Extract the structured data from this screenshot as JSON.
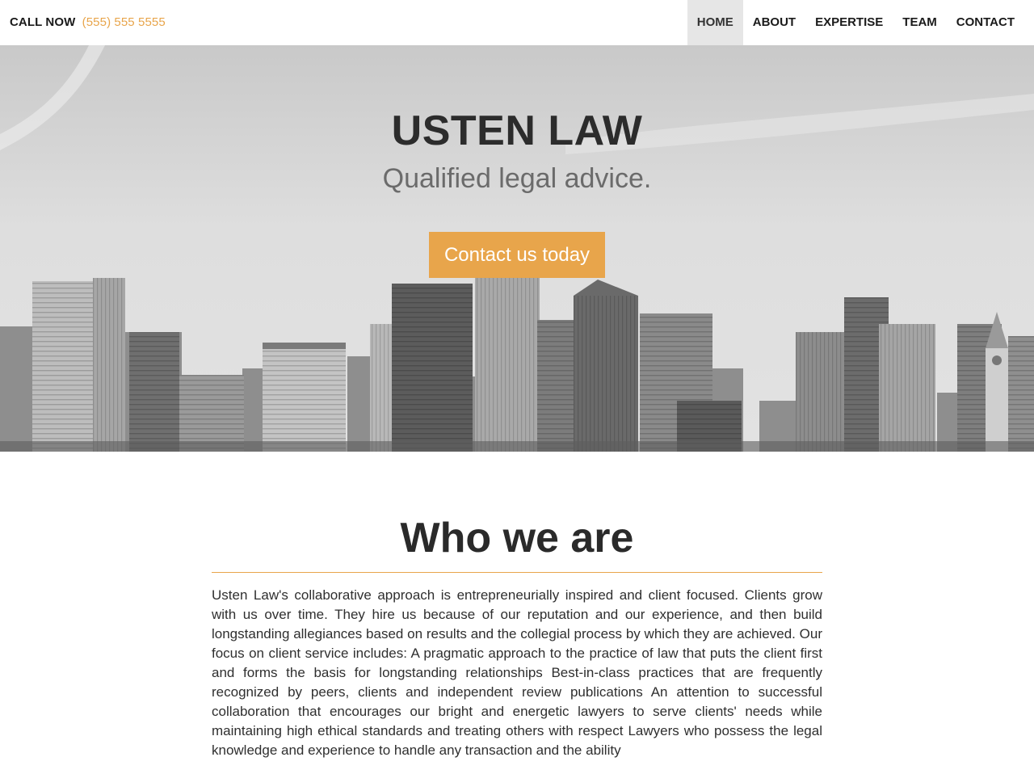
{
  "colors": {
    "accent": "#e8a54b",
    "nav_active_bg": "#e6e6e6",
    "text_dark": "#222222",
    "subtitle_gray": "#6b6b6b"
  },
  "header": {
    "call_label": "CALL NOW",
    "phone": "(555) 555 5555",
    "nav": [
      {
        "label": "HOME",
        "active": true
      },
      {
        "label": "ABOUT",
        "active": false
      },
      {
        "label": "EXPERTISE",
        "active": false
      },
      {
        "label": "TEAM",
        "active": false
      },
      {
        "label": "CONTACT",
        "active": false
      }
    ]
  },
  "hero": {
    "title": "USTEN LAW",
    "subtitle": "Qualified legal advice.",
    "cta_label": "Contact us today"
  },
  "about": {
    "heading": "Who we are",
    "body": "Usten Law's collaborative approach is entrepreneurially inspired and client focused. Clients grow with us over time. They hire us because of our reputation and our experience, and then build longstanding allegiances based on results and the collegial process by which they are achieved. Our focus on client service includes: A pragmatic approach to the practice of law that puts the client first and forms the basis for longstanding relationships Best-in-class practices that are frequently recognized by peers, clients and independent review publications An attention to successful collaboration that encourages our bright and energetic lawyers to serve clients' needs while maintaining high ethical standards and treating others with respect Lawyers who possess the legal knowledge and experience to handle any transaction and the ability"
  }
}
